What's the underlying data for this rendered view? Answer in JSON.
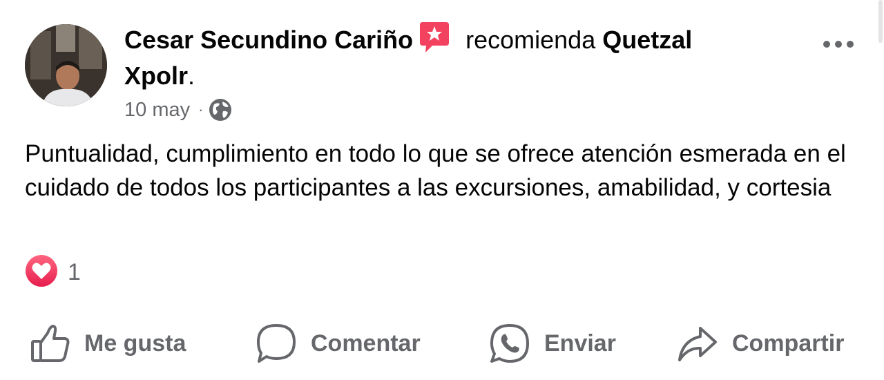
{
  "post": {
    "author": "Cesar Secundino Cariño",
    "verb": "recomienda",
    "page_name": "Quetzal Xpolr",
    "period": ".",
    "date": "10 may",
    "separator": "·",
    "audience_icon": "globe-icon",
    "badge_icon": "recommend-star-icon",
    "text": "Puntualidad, cumplimiento en todo lo que se ofrece atención esmerada en el cuidado de todos los participantes a las excursiones, amabilidad, y cortesia"
  },
  "reactions": {
    "icon": "love-heart-icon",
    "count": "1"
  },
  "actions": {
    "like": {
      "label": "Me gusta",
      "icon": "thumbs-up-icon"
    },
    "comment": {
      "label": "Comentar",
      "icon": "comment-bubble-icon"
    },
    "send": {
      "label": "Enviar",
      "icon": "whatsapp-icon"
    },
    "share": {
      "label": "Compartir",
      "icon": "share-arrow-icon"
    }
  },
  "colors": {
    "text_primary": "#050505",
    "text_secondary": "#65676b",
    "badge": "#f3425f",
    "love": "#f33e58"
  }
}
